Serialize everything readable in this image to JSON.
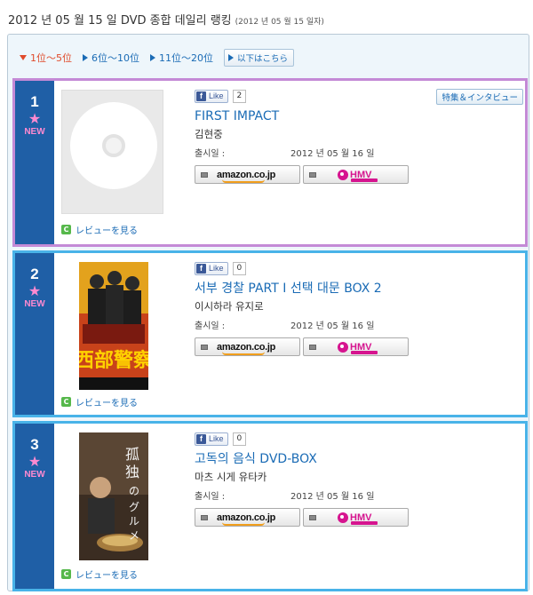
{
  "header": {
    "title": "2012 년 05 월 15 일 DVD 종합 데일리 랭킹",
    "subtitle": "(2012 년 05 월 15 일자)"
  },
  "tabs": [
    {
      "label": "1位～5位",
      "active": true
    },
    {
      "label": "6位～10位",
      "active": false
    },
    {
      "label": "11位～20位",
      "active": false
    }
  ],
  "more_label": "以下はこちら",
  "common": {
    "like_label": "Like",
    "release_label": "출시일 :",
    "review_label": "レビューを見る",
    "amazon_label": "amazon.co.jp",
    "hmv_label": "HMV",
    "new_label": "NEW",
    "star": "★",
    "feature_label": "特集＆インタビュー"
  },
  "items": [
    {
      "rank": "1",
      "title": "FIRST IMPACT",
      "artist": "김현중",
      "release": "2012 년 05 월 16 일",
      "likes": "2"
    },
    {
      "rank": "2",
      "title": "서부 경찰 PART Ⅰ 선택 대문 BOX 2",
      "artist": "이시하라 유지로",
      "release": "2012 년 05 월 16 일",
      "likes": "0"
    },
    {
      "rank": "3",
      "title": "고독의 음식 DVD-BOX",
      "artist": "마츠 시게 유타카",
      "release": "2012 년 05 월 16 일",
      "likes": "0"
    }
  ],
  "colors": {
    "accent": "#1a6bb5",
    "rank_bg": "#1f5fa6",
    "new_pink": "#ff8ad0",
    "border_blue": "#49b3e8",
    "border_first": "#c48ad6"
  }
}
